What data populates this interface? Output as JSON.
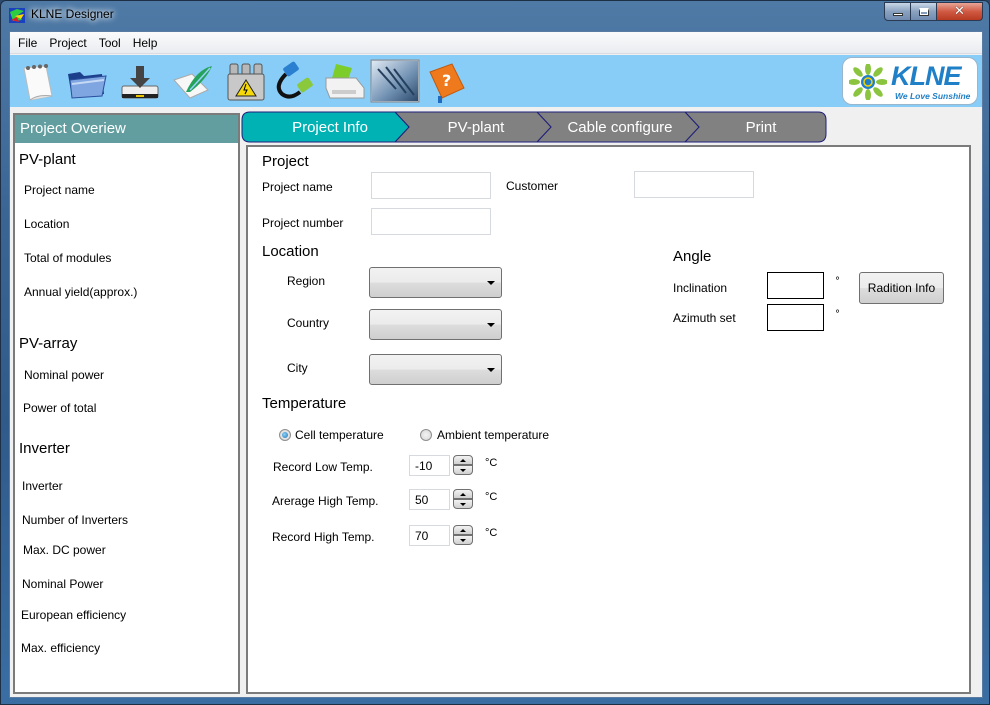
{
  "window": {
    "title": "KLNE Designer",
    "icon": "klne-app-icon",
    "controls": [
      "minimize",
      "maximize",
      "close"
    ]
  },
  "menu": [
    "File",
    "Project",
    "Tool",
    "Help"
  ],
  "toolbar": {
    "icons": [
      {
        "name": "new-project-icon",
        "tooltip": "New"
      },
      {
        "name": "open-folder-icon",
        "tooltip": "Open"
      },
      {
        "name": "save-download-icon",
        "tooltip": "Save"
      },
      {
        "name": "edit-notepad-icon",
        "tooltip": "Edit"
      },
      {
        "name": "inverter-icon",
        "tooltip": "Inverter"
      },
      {
        "name": "cable-icon",
        "tooltip": "Cable"
      },
      {
        "name": "printer-icon",
        "tooltip": "Print"
      },
      {
        "name": "solar-panel-icon",
        "tooltip": "PV-plant"
      },
      {
        "name": "help-book-icon",
        "tooltip": "Help"
      }
    ],
    "logo": {
      "brand": "KLNE",
      "slogan": "We Love Sunshine"
    }
  },
  "overview": {
    "header": "Project Overiew",
    "sections": [
      {
        "title": "PV-plant",
        "items": [
          "Project name",
          "Location",
          "Total of modules",
          "Annual yield(approx.)"
        ]
      },
      {
        "title": "PV-array",
        "items": [
          "Nominal power",
          "Power of total"
        ]
      },
      {
        "title": "Inverter",
        "items": [
          "Inverter",
          "Number of Inverters",
          "Max. DC power",
          "Nominal Power",
          "European efficiency",
          "Max. efficiency"
        ]
      }
    ]
  },
  "tabs": [
    {
      "label": "Project Info",
      "active": true
    },
    {
      "label": "PV-plant",
      "active": false
    },
    {
      "label": "Cable configure",
      "active": false
    },
    {
      "label": "Print",
      "active": false
    }
  ],
  "colors": {
    "active_tab": "#00b2b4",
    "inactive_tab": "#818181",
    "overview_header": "#629e9f",
    "toolbar_bg": "#87cdf7"
  },
  "project": {
    "title": "Project",
    "name_label": "Project name",
    "name_value": "",
    "customer_label": "Customer",
    "customer_value": "",
    "number_label": "Project number",
    "number_value": ""
  },
  "location": {
    "title": "Location",
    "region_label": "Region",
    "region_value": "",
    "country_label": "Country",
    "country_value": "",
    "city_label": "City",
    "city_value": ""
  },
  "angle": {
    "title": "Angle",
    "inclination_label": "Inclination",
    "inclination_value": "",
    "azimuth_label": "Azimuth set",
    "azimuth_value": "",
    "degree_symbol": "°",
    "radiation_button": "Radition Info"
  },
  "temperature": {
    "title": "Temperature",
    "mode_options": [
      {
        "label": "Cell temperature",
        "checked": true
      },
      {
        "label": "Ambient temperature",
        "checked": false
      }
    ],
    "rows": [
      {
        "label": "Record Low Temp.",
        "value": "-10",
        "unit": "°C"
      },
      {
        "label": "Arerage High Temp.",
        "value": "50",
        "unit": "°C"
      },
      {
        "label": "Record High Temp.",
        "value": "70",
        "unit": "°C"
      }
    ]
  }
}
